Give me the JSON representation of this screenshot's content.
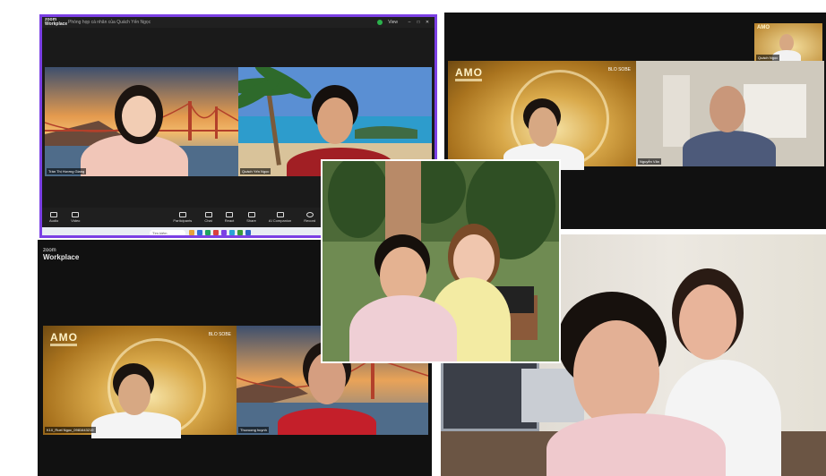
{
  "panel1": {
    "brand_line1": "zoom",
    "brand_line2": "Workplace",
    "window_title": "Phòng họp cá nhân của Quách Yến Ngọc",
    "view_label": "View",
    "tile_left_name": "Trần Thị Hương Giang",
    "tile_right_name": "Quách Yến Ngọc",
    "toolbar": {
      "audio": "Audio",
      "video": "Video",
      "participants": "Participants",
      "participants_count": "2",
      "chat": "Chat",
      "react": "React",
      "share": "Share",
      "ai": "AI Companion",
      "record": "Record"
    },
    "taskbar_search": "Tìm kiếm"
  },
  "panel2": {
    "amo_logo": "AMO",
    "amo_brand": "BLO SOBE",
    "name_right": "Nguyễn Văn",
    "self_view_name": "Quách Ngọc"
  },
  "panel3": {
    "brand_line1": "zoom",
    "brand_line2": "Workplace",
    "amo_logo": "AMO",
    "amo_brand": "BLO SOBE",
    "tile_left_name": "K10_Ruel Ngọc_0981643219",
    "tile_right_name": "Thuvuong huynh"
  },
  "colors": {
    "accent_border": "#7b3fe4",
    "gold": "#d9a94a"
  }
}
